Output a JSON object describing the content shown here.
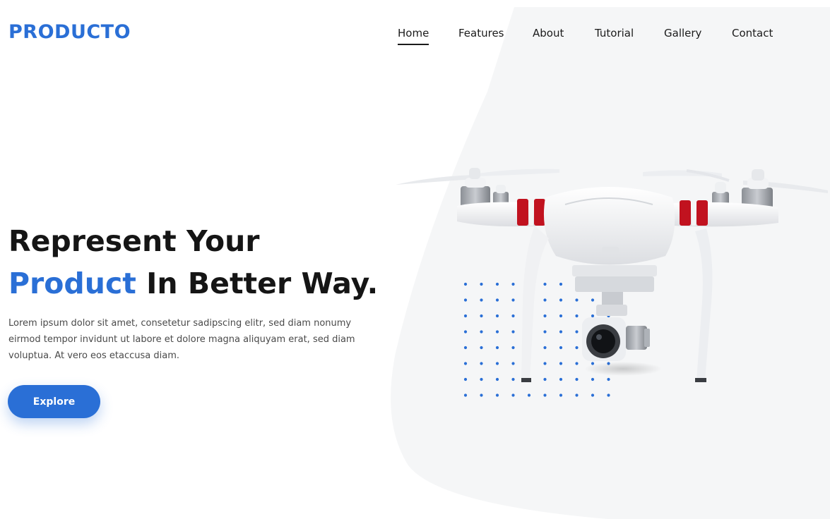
{
  "brand": {
    "name": "PRODUCTO"
  },
  "nav": {
    "items": [
      {
        "label": "Home",
        "active": true
      },
      {
        "label": "Features",
        "active": false
      },
      {
        "label": "About",
        "active": false
      },
      {
        "label": "Tutorial",
        "active": false
      },
      {
        "label": "Gallery",
        "active": false
      },
      {
        "label": "Contact",
        "active": false
      }
    ]
  },
  "hero": {
    "headline_line1": "Represent Your",
    "headline_accent": "Product",
    "headline_rest": " In Better Way.",
    "description": "Lorem ipsum dolor sit amet, consetetur sadipscing elitr, sed diam nonumy eirmod tempor invidunt ut labore et dolore magna aliquyam erat, sed diam voluptua. At vero eos etaccusa diam.",
    "cta_label": "Explore"
  },
  "colors": {
    "accent": "#2a6fd6",
    "background_shape": "#f5f6f7",
    "text": "#1b1b1b"
  },
  "icons": {
    "product_image": "drone-image",
    "pattern": "dot-grid-pattern"
  }
}
